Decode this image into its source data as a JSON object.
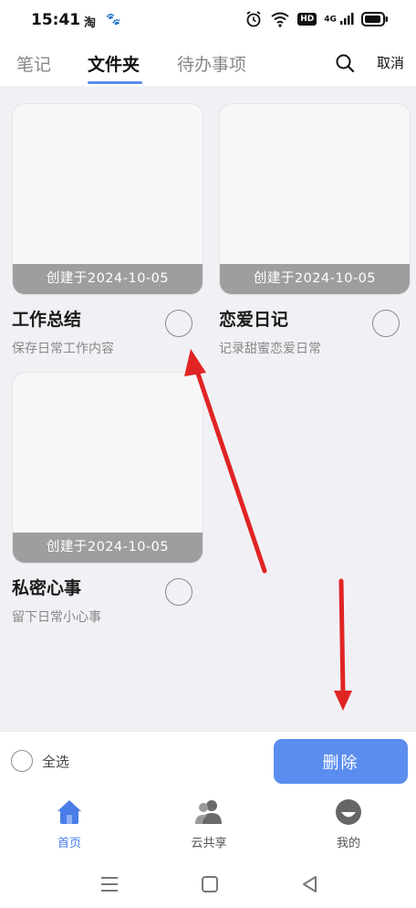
{
  "status": {
    "time": "15:41",
    "apps": [
      "淘",
      "🐾"
    ],
    "hd": "HD",
    "net": "4G"
  },
  "tabs": [
    {
      "label": "笔记",
      "active": false
    },
    {
      "label": "文件夹",
      "active": true
    },
    {
      "label": "待办事项",
      "active": false
    }
  ],
  "header": {
    "cancel_label": "取消",
    "search_icon": "search-icon"
  },
  "folders": [
    {
      "title": "工作总结",
      "desc": "保存日常工作内容",
      "date": "创建于2024-10-05"
    },
    {
      "title": "恋爱日记",
      "desc": "记录甜蜜恋爱日常",
      "date": "创建于2024-10-05"
    },
    {
      "title": "私密心事",
      "desc": "留下日常小心事",
      "date": "创建于2024-10-05"
    }
  ],
  "action_bar": {
    "select_all_label": "全选",
    "delete_label": "删除"
  },
  "bottom_nav": [
    {
      "label": "首页",
      "icon": "home-icon",
      "active": true
    },
    {
      "label": "云共享",
      "icon": "users-icon",
      "active": false
    },
    {
      "label": "我的",
      "icon": "profile-icon",
      "active": false
    }
  ],
  "colors": {
    "accent": "#5b8def",
    "annotation_arrow": "#e02424",
    "content_bg": "#f1f1f5"
  }
}
